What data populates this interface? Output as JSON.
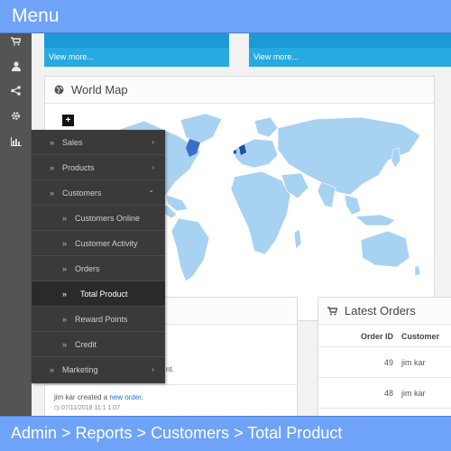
{
  "header": {
    "title": "Menu"
  },
  "footer": {
    "breadcrumb": "Admin > Reports > Customers > Total Product"
  },
  "iconbar": {
    "icons": [
      "cart-icon",
      "user-icon",
      "share-icon",
      "gear-icon",
      "bar-chart-icon"
    ]
  },
  "tiles": [
    {
      "link": "View more..."
    },
    {
      "link": "View more..."
    }
  ],
  "map_panel": {
    "title": "World Map",
    "zoom_label": "+"
  },
  "menu": {
    "items": [
      {
        "label": "Sales",
        "level": "top",
        "caret": "›"
      },
      {
        "label": "Products",
        "level": "top",
        "caret": "›"
      },
      {
        "label": "Customers",
        "level": "top",
        "caret": "⌄"
      },
      {
        "label": "Customers Online",
        "level": "sub"
      },
      {
        "label": "Customer Activity",
        "level": "sub"
      },
      {
        "label": "Orders",
        "level": "sub"
      },
      {
        "label": "Total Product",
        "level": "sub",
        "active": true
      },
      {
        "label": "Reward Points",
        "level": "sub"
      },
      {
        "label": "Credit",
        "level": "sub"
      },
      {
        "label": "Marketing",
        "level": "top",
        "caret": "›"
      }
    ],
    "arrow": "»"
  },
  "activity": {
    "partial_text": "nt.",
    "entry_user": "jim kar created a ",
    "entry_link": "new order",
    "entry_end": ".",
    "timestamp": "◷ 07/11/2018 11:1 1:07"
  },
  "orders": {
    "title": "Latest Orders",
    "columns": [
      "Order ID",
      "Customer"
    ],
    "rows": [
      {
        "id": "49",
        "customer": "jim kar"
      },
      {
        "id": "48",
        "customer": "jim kar"
      }
    ]
  },
  "colors": {
    "header_blue": "#6fa3f7",
    "tile_blue": "#27aae1",
    "menu_bg": "#3a3a3a",
    "map_land": "#a8d2f2",
    "map_highlight": "#1f4e9e"
  }
}
